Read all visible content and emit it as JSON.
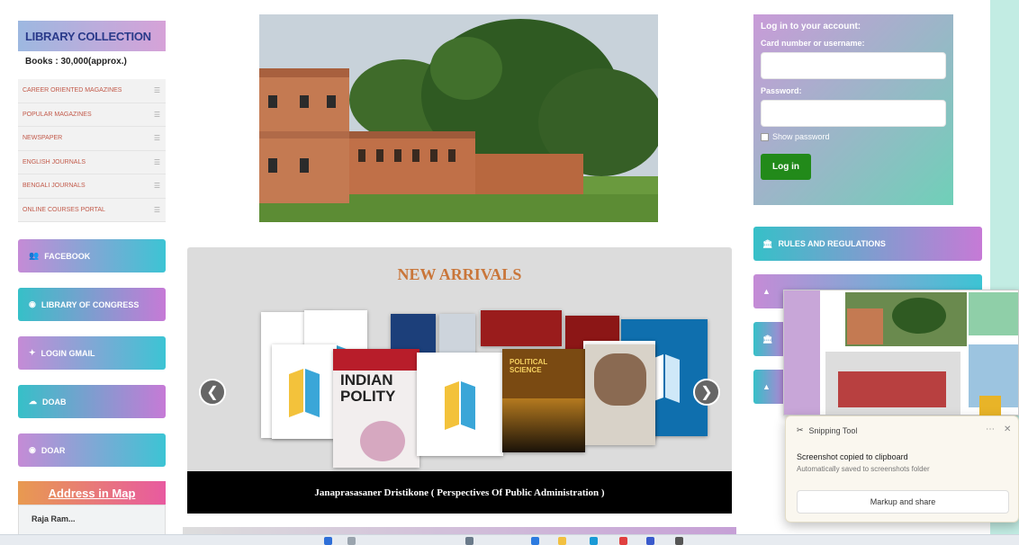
{
  "sidebar": {
    "title": "LIBRARY COLLECTION",
    "books_count": "Books : 30,000(approx.)",
    "collections": [
      {
        "label": "CAREER ORIENTED MAGAZINES"
      },
      {
        "label": "POPULAR MAGAZINES"
      },
      {
        "label": "NEWSPAPER"
      },
      {
        "label": "ENGLISH JOURNALS"
      },
      {
        "label": "BENGALI JOURNALS"
      },
      {
        "label": "ONLINE COURSES PORTAL"
      }
    ],
    "links": [
      {
        "label": "FACEBOOK",
        "icon": "users-icon"
      },
      {
        "label": "LIBRARY OF CONGRESS",
        "icon": "camera-icon"
      },
      {
        "label": "LOGIN GMAIL",
        "icon": "group-icon"
      },
      {
        "label": "DOAB",
        "icon": "cloud-icon"
      },
      {
        "label": "DOAR",
        "icon": "camera-icon"
      }
    ],
    "address_title": "Address in Map",
    "map_text": "Raja Ram..."
  },
  "carousel": {
    "title": "NEW ARRIVALS",
    "caption": "Janaprasasaner Dristikone ( Perspectives Of Public Administration )",
    "prev_icon": "chevron-left-icon",
    "next_icon": "chevron-right-icon",
    "book_titles": [
      "INDIAN POLITY",
      "POLITICAL SCIENCE"
    ]
  },
  "login": {
    "title": "Log in to your account:",
    "username_label": "Card number or username:",
    "password_label": "Password:",
    "show_password": "Show password",
    "submit": "Log in"
  },
  "right_links": [
    {
      "label": "RULES AND REGULATIONS",
      "icon": "bank-icon"
    }
  ],
  "snipping": {
    "app": "Snipping Tool",
    "message": "Screenshot copied to clipboard",
    "sub": "Automatically saved to screenshots folder",
    "action": "Markup and share"
  },
  "colors": {
    "accent_green": "#228a1a",
    "title_orange": "#c9763a",
    "link_blue": "#2a3a8a"
  }
}
